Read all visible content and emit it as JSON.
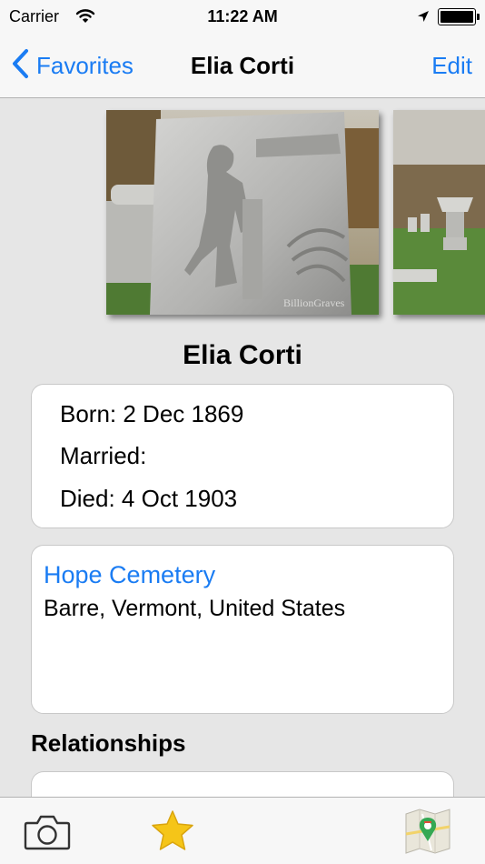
{
  "status_bar": {
    "carrier": "Carrier",
    "time": "11:22 AM",
    "icons": [
      "wifi-icon",
      "location-arrow-icon",
      "battery-icon"
    ]
  },
  "nav": {
    "back_label": "Favorites",
    "title": "Elia Corti",
    "edit_label": "Edit",
    "tint_color": "#1a7cf3"
  },
  "photos": {
    "count_visible": 2,
    "watermark": "BillionGraves"
  },
  "person": {
    "name": "Elia Corti",
    "born": "Born: 2 Dec 1869",
    "married": "Married:",
    "died": "Died: 4 Oct 1903"
  },
  "cemetery": {
    "name": "Hope Cemetery",
    "location": "Barre, Vermont, United States"
  },
  "relationships": {
    "title": "Relationships"
  },
  "tab_bar": {
    "items": [
      "camera-icon",
      "star-icon",
      "map-icon"
    ],
    "star_color": "#f5c518"
  }
}
